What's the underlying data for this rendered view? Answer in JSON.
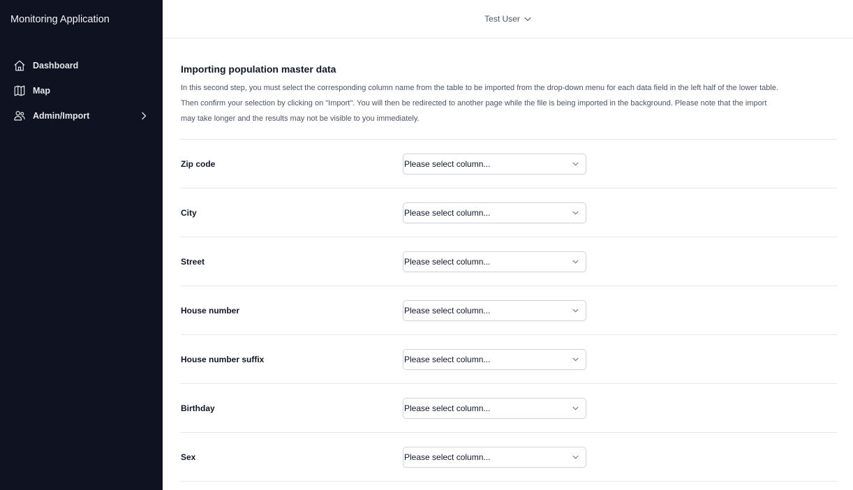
{
  "app": {
    "title": "Monitoring Application"
  },
  "sidebar": {
    "items": [
      {
        "label": "Dashboard",
        "icon": "home-icon"
      },
      {
        "label": "Map",
        "icon": "map-icon"
      },
      {
        "label": "Admin/Import",
        "icon": "users-icon",
        "has_submenu": true
      }
    ]
  },
  "header": {
    "user_name": "Test User"
  },
  "main": {
    "title": "Importing population master data",
    "intro_line1": "In this second step, you must select the corresponding column name from the table to be imported from the drop-down menu for each data field in the left half of the lower table.",
    "intro_line2": "Then confirm your selection by clicking on \"Import\". You will then be redirected to another page while the file is being imported in the background. Please note that the import",
    "intro_line3": "may take longer and the results may not be visible to you immediately.",
    "fields": [
      {
        "label": "Zip code",
        "selected": "Please select column..."
      },
      {
        "label": "City",
        "selected": "Please select column..."
      },
      {
        "label": "Street",
        "selected": "Please select column..."
      },
      {
        "label": "House number",
        "selected": "Please select column..."
      },
      {
        "label": "House number suffix",
        "selected": "Please select column..."
      },
      {
        "label": "Birthday",
        "selected": "Please select column..."
      },
      {
        "label": "Sex",
        "selected": "Please select column..."
      }
    ]
  },
  "colors": {
    "sidebar_bg": "#0f1220",
    "border": "#e5e7eb",
    "text_primary": "#111827",
    "text_secondary": "#4b5563"
  }
}
